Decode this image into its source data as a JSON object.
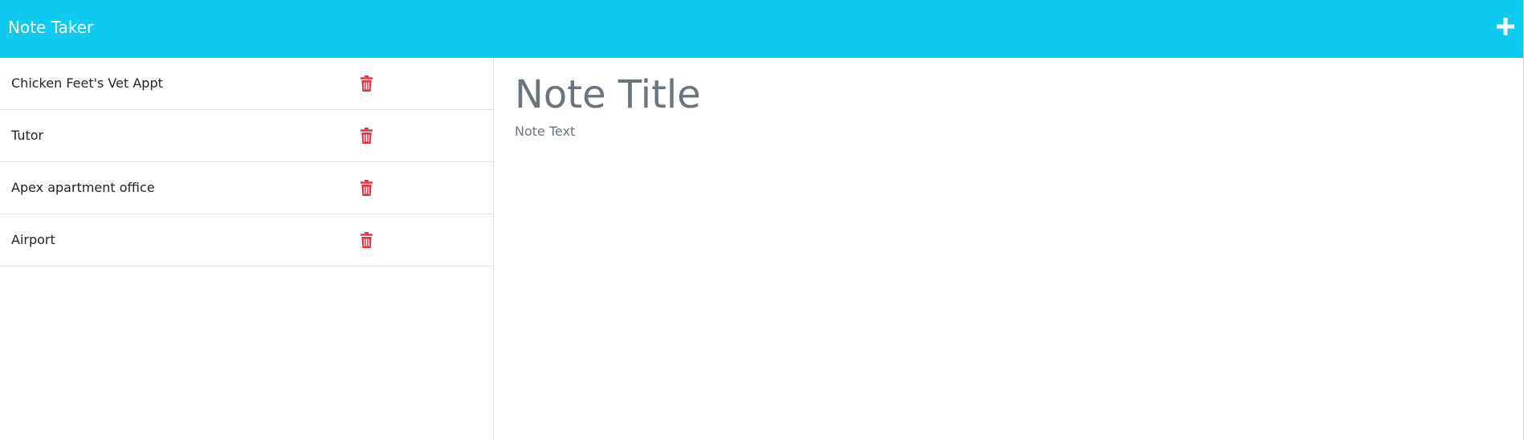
{
  "app": {
    "title": "Note Taker",
    "new_note_icon": "plus-icon",
    "accent_color": "#0dcaf0",
    "delete_color": "#dc3545"
  },
  "notes": [
    {
      "title": "Chicken Feet's Vet Appt",
      "delete_icon": "trash-icon"
    },
    {
      "title": "Tutor",
      "delete_icon": "trash-icon"
    },
    {
      "title": "Apex apartment office",
      "delete_icon": "trash-icon"
    },
    {
      "title": "Airport",
      "delete_icon": "trash-icon"
    }
  ],
  "editor": {
    "title_placeholder": "Note Title",
    "title_value": "",
    "text_placeholder": "Note Text",
    "text_value": ""
  }
}
